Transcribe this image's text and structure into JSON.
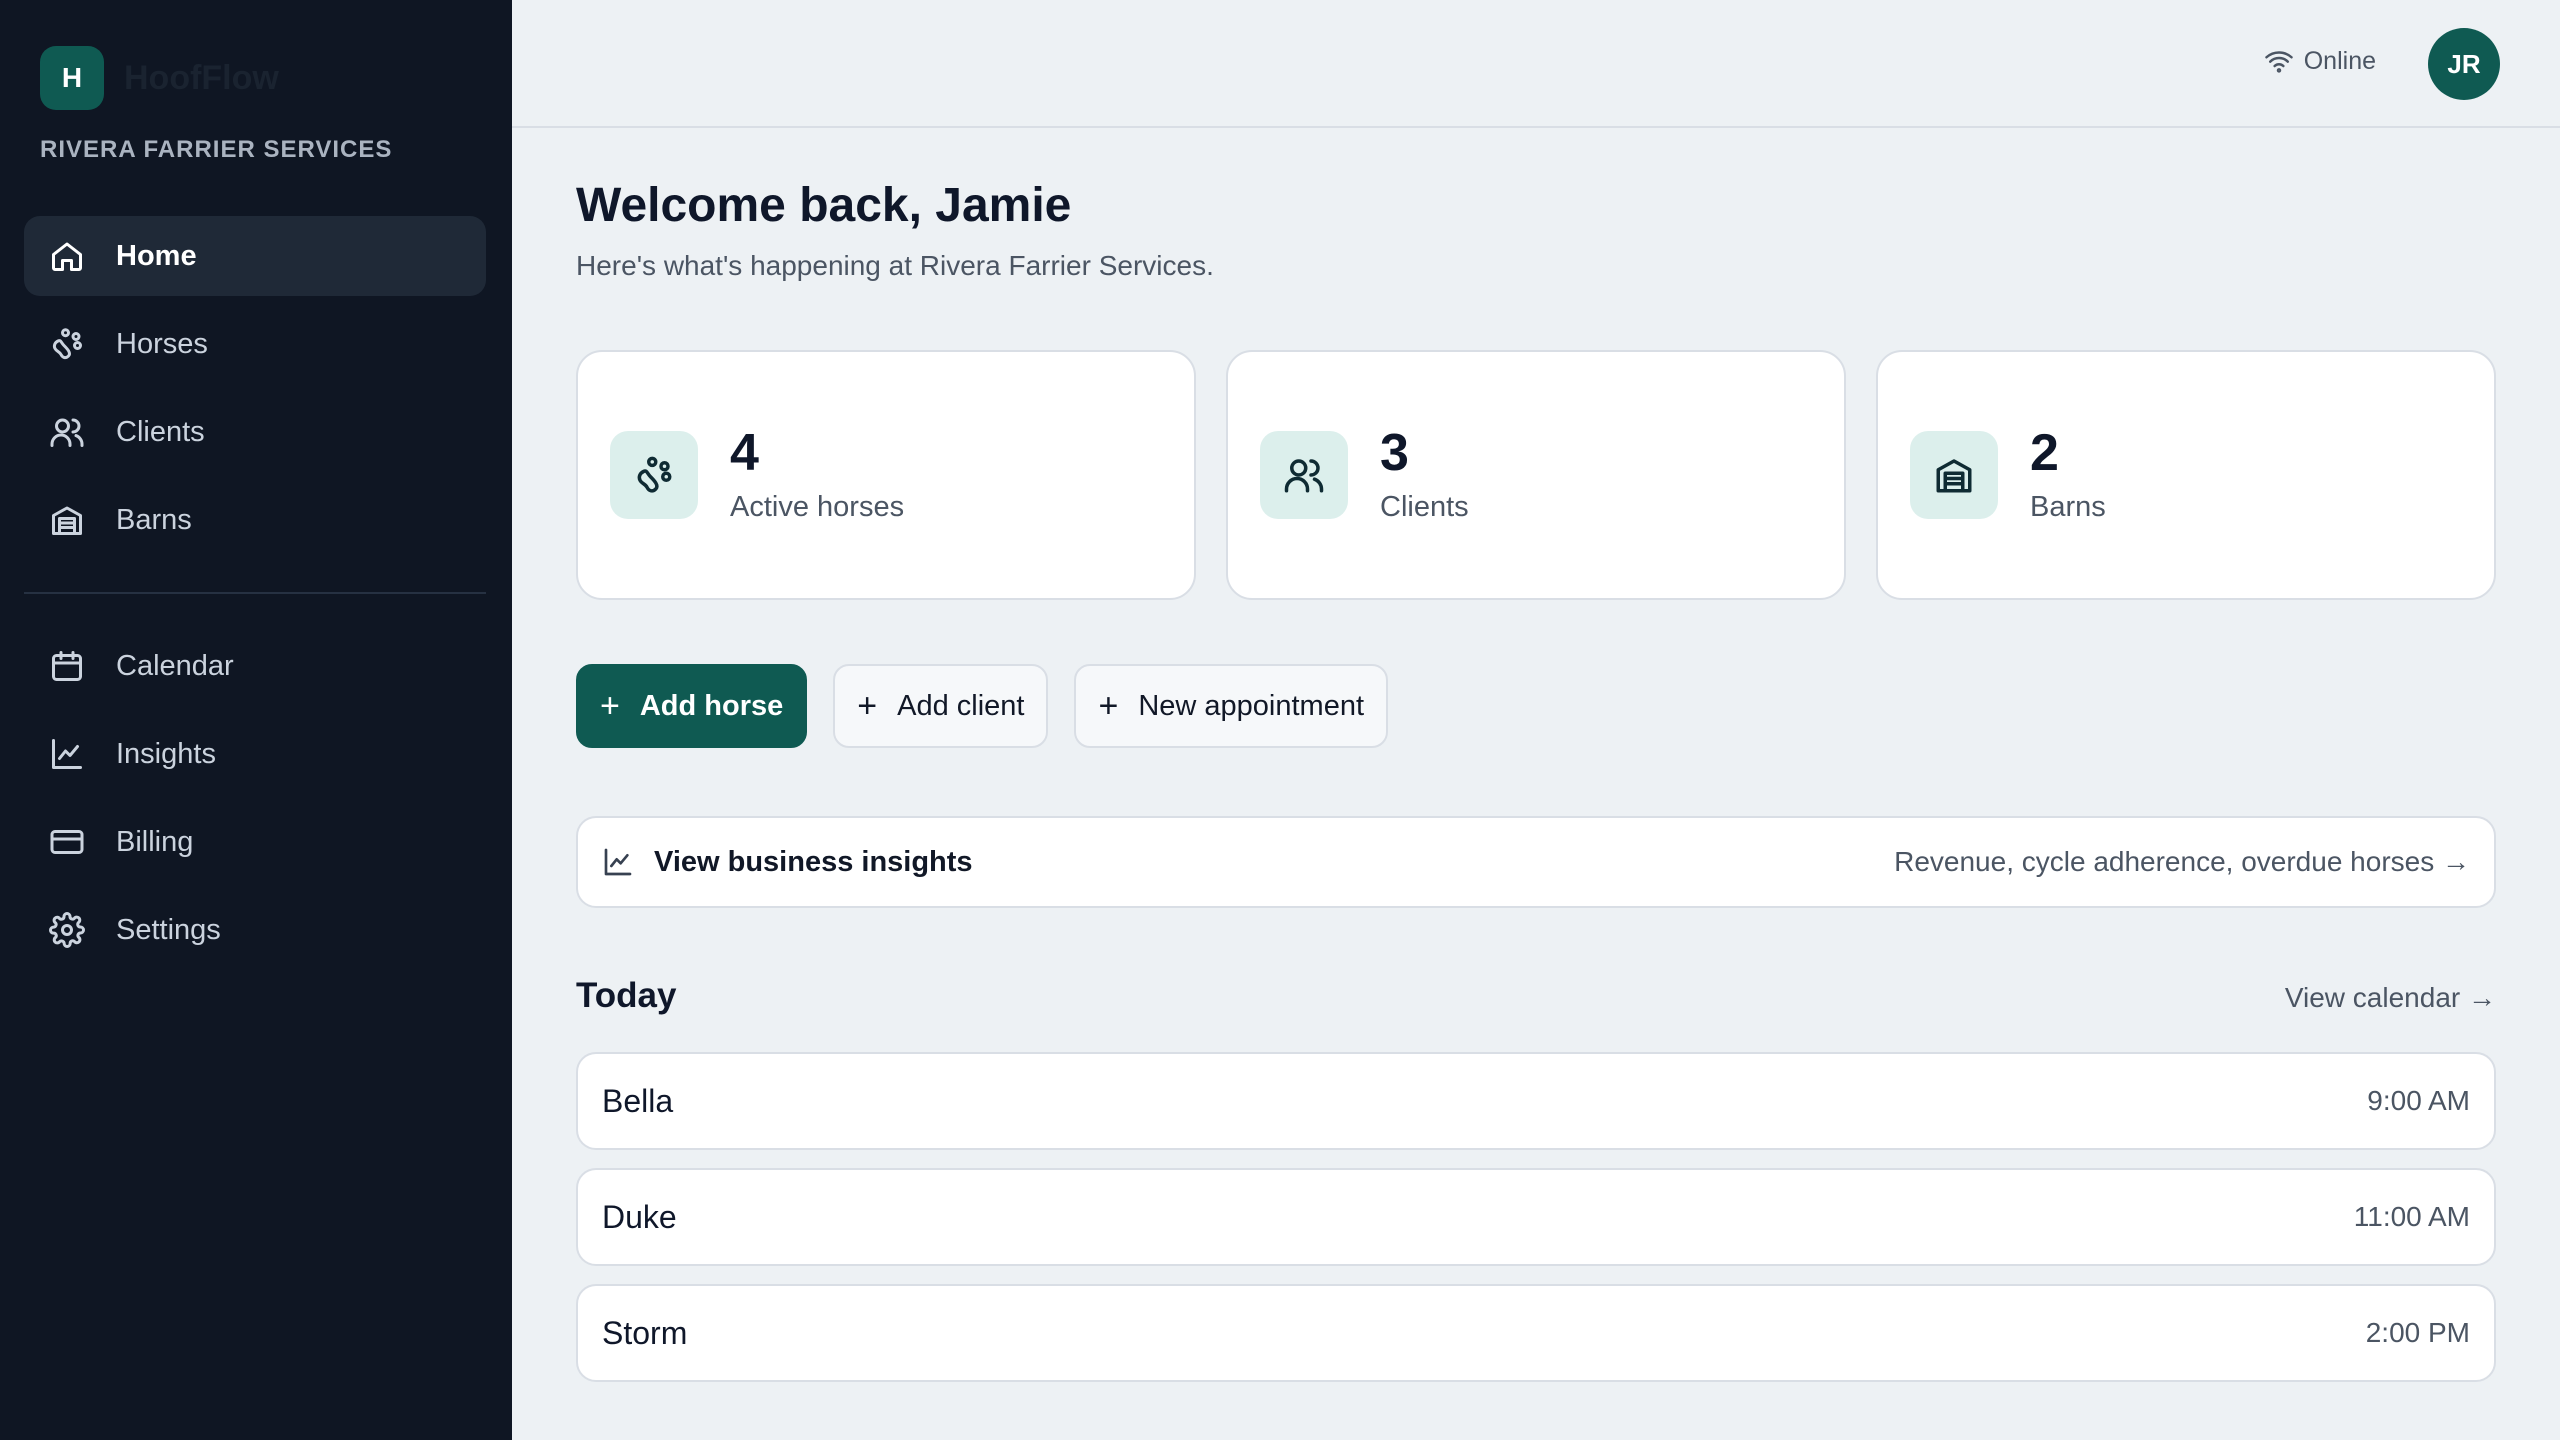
{
  "brand": {
    "mark": "H",
    "name": "HoofFlow",
    "company": "RIVERA FARRIER SERVICES"
  },
  "sidebar": {
    "primary": [
      {
        "label": "Home",
        "icon": "home-icon",
        "active": true
      },
      {
        "label": "Horses",
        "icon": "horse-icon"
      },
      {
        "label": "Clients",
        "icon": "users-icon"
      },
      {
        "label": "Barns",
        "icon": "barn-icon"
      }
    ],
    "secondary": [
      {
        "label": "Calendar",
        "icon": "calendar-icon"
      },
      {
        "label": "Insights",
        "icon": "chart-icon"
      },
      {
        "label": "Billing",
        "icon": "credit-card-icon"
      },
      {
        "label": "Settings",
        "icon": "gear-icon"
      }
    ]
  },
  "topbar": {
    "status": "Online",
    "avatar_initials": "JR"
  },
  "main": {
    "welcome": "Welcome back, Jamie",
    "subtitle": "Here's what's happening at Rivera Farrier Services."
  },
  "stats": [
    {
      "value": "4",
      "label": "Active horses",
      "icon": "horse-icon"
    },
    {
      "value": "3",
      "label": "Clients",
      "icon": "users-icon"
    },
    {
      "value": "2",
      "label": "Barns",
      "icon": "barn-icon"
    }
  ],
  "actions": {
    "add_horse": "Add horse",
    "add_client": "Add client",
    "new_appointment": "New appointment"
  },
  "insights": {
    "title": "View business insights",
    "description": "Revenue, cycle adherence, overdue horses →"
  },
  "today": {
    "title": "Today",
    "view_calendar": "View calendar →",
    "appointments": [
      {
        "name": "Bella",
        "time": "9:00 AM"
      },
      {
        "name": "Duke",
        "time": "11:00 AM"
      },
      {
        "name": "Storm",
        "time": "2:00 PM"
      }
    ]
  },
  "colors": {
    "accent": "#0f5a52",
    "sidebar_bg": "#0f1623",
    "page_bg": "#edf1f4",
    "icon_tile": "#dcefec"
  }
}
